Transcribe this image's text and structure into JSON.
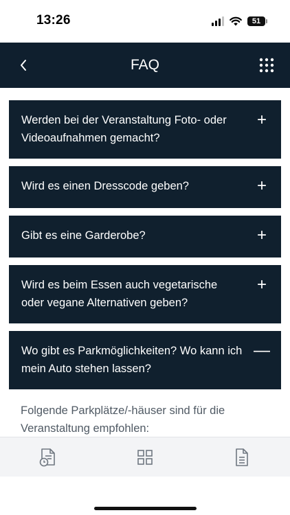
{
  "status_bar": {
    "time": "13:26",
    "battery": "51"
  },
  "header": {
    "title": "FAQ",
    "back_icon": "chevron-left-icon",
    "menu_icon": "grid-dots-icon"
  },
  "faq": {
    "items": [
      {
        "question": "Werden bei der Veranstaltung Foto- oder Videoaufnahmen gemacht?",
        "toggle": "+"
      },
      {
        "question": "Wird es einen Dresscode geben?",
        "toggle": "+"
      },
      {
        "question": "Gibt es eine Garderobe?",
        "toggle": "+"
      },
      {
        "question": "Wird es beim Essen auch vegetarische oder vegane Alternativen geben?",
        "toggle": "+"
      },
      {
        "question": "Wo gibt es Parkmöglichkeiten? Wo kann ich mein Auto stehen lassen?",
        "toggle": "—"
      }
    ],
    "expanded_answer": "Folgende Parkplätze/-häuser sind für die Veranstaltung empfohlen:"
  },
  "bottom_nav": {
    "items": [
      {
        "icon": "schedule-document-icon"
      },
      {
        "icon": "dashboard-grid-icon"
      },
      {
        "icon": "document-icon"
      }
    ]
  },
  "colors": {
    "header_bg": "#0f1f2e",
    "card_bg": "#10202e",
    "answer_text": "#505a64",
    "nav_bg": "#f3f4f6"
  }
}
